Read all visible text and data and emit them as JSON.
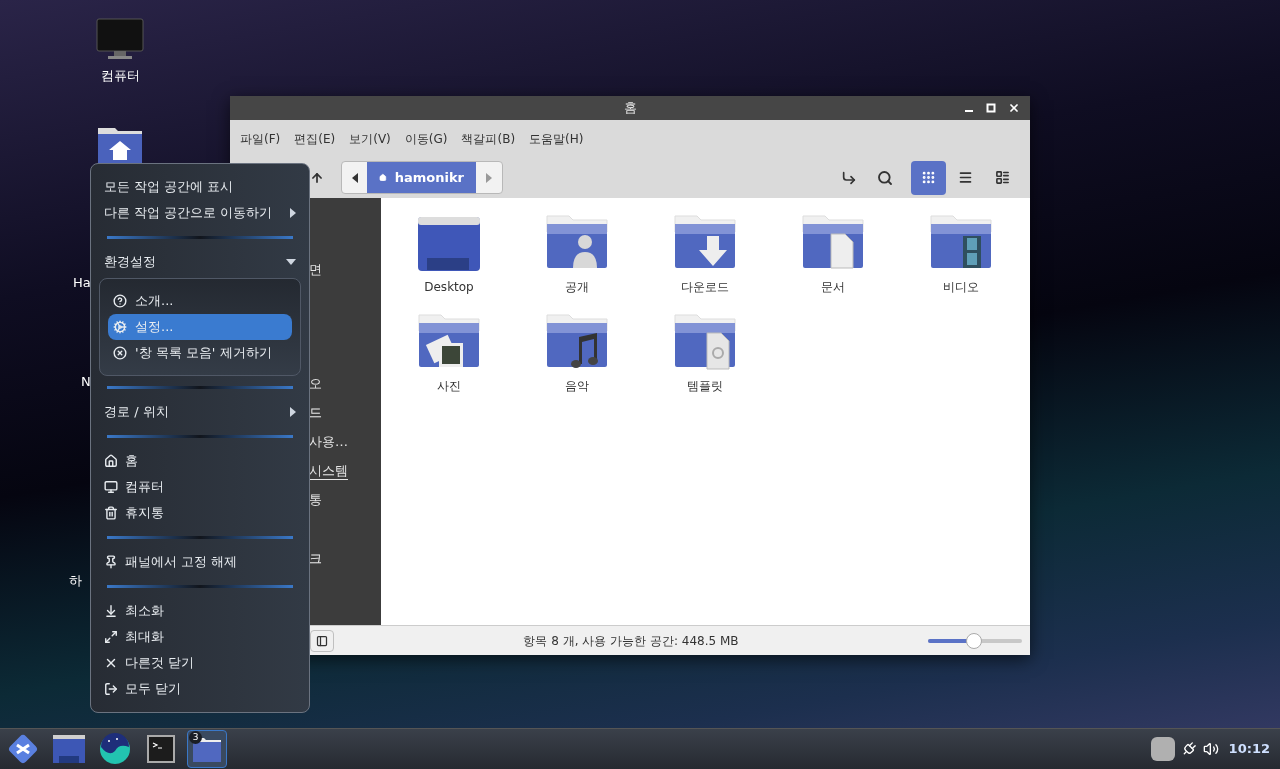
{
  "desktop": {
    "icons": [
      {
        "kind": "computer",
        "label": "컴퓨터"
      },
      {
        "kind": "home"
      }
    ],
    "cut_labels": [
      "Ha",
      "N",
      "하"
    ]
  },
  "window": {
    "title": "홈",
    "menu": [
      "파일(F)",
      "편집(E)",
      "보기(V)",
      "이동(G)",
      "책갈피(B)",
      "도움말(H)"
    ],
    "path": "hamonikr",
    "views": [
      {
        "kind": "icons",
        "selected": true
      },
      {
        "kind": "list",
        "selected": false
      },
      {
        "kind": "compact",
        "selected": false
      }
    ],
    "sidebar": [
      {
        "label": "면",
        "hovered": false
      },
      {
        "label": "오",
        "hovered": false
      },
      {
        "label": "드",
        "hovered": false
      },
      {
        "label": "사용…",
        "hovered": false
      },
      {
        "label": "시스템",
        "hovered": true
      },
      {
        "label": "통",
        "hovered": false
      },
      {
        "label": "크",
        "hovered": false
      }
    ],
    "files": [
      {
        "kind": "desktop",
        "label": "Desktop"
      },
      {
        "kind": "public",
        "label": "공개"
      },
      {
        "kind": "download",
        "label": "다운로드"
      },
      {
        "kind": "documents",
        "label": "문서"
      },
      {
        "kind": "videos",
        "label": "비디오"
      },
      {
        "kind": "pictures",
        "label": "사진"
      },
      {
        "kind": "music",
        "label": "음악"
      },
      {
        "kind": "templates",
        "label": "템플릿"
      }
    ],
    "status": "항목 8 개, 사용 가능한 공간: 448.5 MB",
    "zoom": {
      "level": 0.49
    }
  },
  "context_menu": {
    "groups": [
      {
        "items": [
          {
            "label": "모든 작업 공간에 표시",
            "submenu": false
          },
          {
            "label": "다른 작업 공간으로 이동하기",
            "submenu": true
          }
        ]
      },
      {
        "section": {
          "label": "환경설정",
          "expanded": true
        },
        "items": [
          {
            "label": "소개...",
            "selected": false
          },
          {
            "label": "설정...",
            "selected": true
          },
          {
            "label": "'창 목록 모음' 제거하기",
            "selected": false
          }
        ]
      },
      {
        "items": [
          {
            "label": "경로 / 위치",
            "submenu": true
          }
        ]
      },
      {
        "items": [
          {
            "label": "홈"
          },
          {
            "label": "컴퓨터"
          },
          {
            "label": "휴지통"
          }
        ]
      },
      {
        "items": [
          {
            "label": "패널에서 고정 해제"
          }
        ]
      },
      {
        "items": [
          {
            "label": "최소화"
          },
          {
            "label": "최대화"
          },
          {
            "label": "다른것 닫기"
          },
          {
            "label": "모두 닫기"
          }
        ]
      }
    ]
  },
  "taskbar": {
    "apps": [
      {
        "kind": "launcher",
        "active": false
      },
      {
        "kind": "show-desktop",
        "active": false
      },
      {
        "kind": "browser",
        "active": false
      },
      {
        "kind": "terminal",
        "active": false
      },
      {
        "kind": "files",
        "active": true,
        "badge": "3"
      }
    ],
    "clock": "10:12"
  }
}
